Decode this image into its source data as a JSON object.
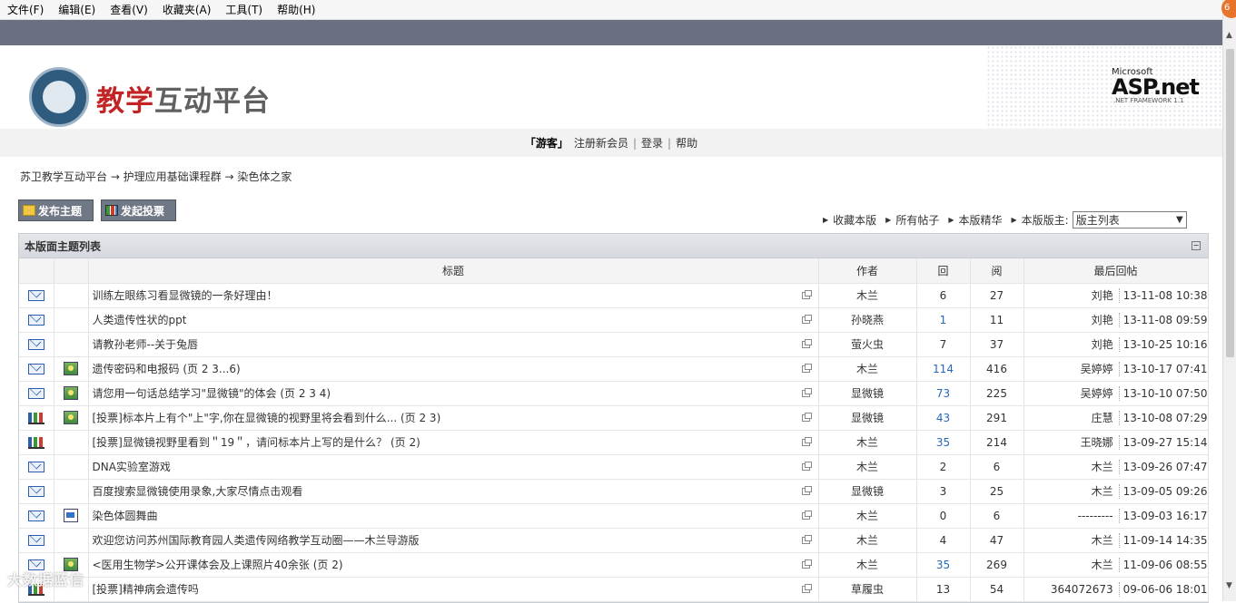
{
  "menu": [
    "文件(F)",
    "编辑(E)",
    "查看(V)",
    "收藏夹(A)",
    "工具(T)",
    "帮助(H)"
  ],
  "browser_badge": "6",
  "header": {
    "logo_red": "教学",
    "logo_gray": "互动平台",
    "aspnet_ms": "Microsoft",
    "aspnet_asp": "ASP.net",
    "aspnet_fw": ".NET FRAMEWORK 1.1"
  },
  "userbar": {
    "guest": "「游客」",
    "register": "注册新会员",
    "login": "登录",
    "help": "帮助"
  },
  "breadcrumb": "苏卫教学互动平台 → 护理应用基础课程群 → 染色体之家",
  "actions": {
    "new_topic": "发布主题",
    "new_poll": "发起投票"
  },
  "forum_links": {
    "favorite": "收藏本版",
    "all_posts": "所有帖子",
    "digest": "本版精华",
    "moderators_label": "本版版主:",
    "moderators_select": "版主列表"
  },
  "panel": {
    "title": "本版面主题列表",
    "collapse": "⊟"
  },
  "columns": {
    "title": "标题",
    "author": "作者",
    "replies": "回",
    "views": "阅",
    "last": "最后回帖"
  },
  "rows": [
    {
      "icon": "envelope",
      "img": "",
      "title": "训练左眼练习看显微镜的一条好理由！",
      "pages": "",
      "author": "木兰",
      "replies": "6",
      "reply_link": false,
      "views": "27",
      "last_user": "刘艳",
      "last_time": "13-11-08 10:38"
    },
    {
      "icon": "envelope",
      "img": "",
      "title": "人类遗传性状的ppt",
      "pages": "",
      "author": "孙晓燕",
      "replies": "1",
      "reply_link": true,
      "views": "11",
      "last_user": "刘艳",
      "last_time": "13-11-08 09:59"
    },
    {
      "icon": "envelope",
      "img": "",
      "title": "请教孙老师--关于兔唇",
      "pages": "",
      "author": "萤火虫",
      "replies": "7",
      "reply_link": false,
      "views": "37",
      "last_user": "刘艳",
      "last_time": "13-10-25 10:16"
    },
    {
      "icon": "envelope",
      "img": "image",
      "title": "遗传密码和电报码",
      "pages": " (页 2 3...6)",
      "author": "木兰",
      "replies": "114",
      "reply_link": true,
      "views": "416",
      "last_user": "吴婷婷",
      "last_time": "13-10-17 07:41"
    },
    {
      "icon": "envelope",
      "img": "image",
      "title": "请您用一句话总结学习\"显微镜\"的体会",
      "pages": " (页 2 3 4)",
      "author": "显微镜",
      "replies": "73",
      "reply_link": true,
      "views": "225",
      "last_user": "吴婷婷",
      "last_time": "13-10-10 07:50"
    },
    {
      "icon": "vote",
      "img": "image",
      "title": "[投票]标本片上有个\"上\"字,你在显微镜的视野里将会看到什么...",
      "pages": " (页 2 3)",
      "author": "显微镜",
      "replies": "43",
      "reply_link": true,
      "views": "291",
      "last_user": "庄慧",
      "last_time": "13-10-08 07:29"
    },
    {
      "icon": "vote",
      "img": "",
      "title": "[投票]显微镜视野里看到＂19＂，请问标本片上写的是什么？",
      "pages": " (页 2)",
      "author": "木兰",
      "replies": "35",
      "reply_link": true,
      "views": "214",
      "last_user": "王晓娜",
      "last_time": "13-09-27 15:14"
    },
    {
      "icon": "envelope",
      "img": "",
      "title": "DNA实验室游戏",
      "pages": "",
      "author": "木兰",
      "replies": "2",
      "reply_link": false,
      "views": "6",
      "last_user": "木兰",
      "last_time": "13-09-26 07:47"
    },
    {
      "icon": "envelope",
      "img": "",
      "title": "百度搜索显微镜使用录象,大家尽情点击观看",
      "pages": "",
      "author": "显微镜",
      "replies": "3",
      "reply_link": false,
      "views": "25",
      "last_user": "木兰",
      "last_time": "13-09-05 09:26"
    },
    {
      "icon": "envelope",
      "img": "doc",
      "title": "染色体圆舞曲",
      "pages": "",
      "author": "木兰",
      "replies": "0",
      "reply_link": false,
      "views": "6",
      "last_user": "---------",
      "last_time": "13-09-03 16:17"
    },
    {
      "icon": "envelope",
      "img": "",
      "title": "欢迎您访问苏州国际教育园人类遗传网络教学互动圈——木兰导游版",
      "pages": "",
      "author": "木兰",
      "replies": "4",
      "reply_link": false,
      "views": "47",
      "last_user": "木兰",
      "last_time": "11-09-14 14:35"
    },
    {
      "icon": "envelope",
      "img": "image",
      "title": "<医用生物学>公开课体会及上课照片40余张",
      "pages": " (页 2)",
      "author": "木兰",
      "replies": "35",
      "reply_link": true,
      "views": "269",
      "last_user": "木兰",
      "last_time": "11-09-06 08:55"
    },
    {
      "icon": "vote",
      "img": "",
      "title": "[投票]精神病会遗传吗",
      "pages": "",
      "author": "草履虫",
      "replies": "13",
      "reply_link": false,
      "views": "54",
      "last_user": "364072673",
      "last_time": "09-06-06 18:01"
    }
  ],
  "watermark": "大数据蓝信"
}
